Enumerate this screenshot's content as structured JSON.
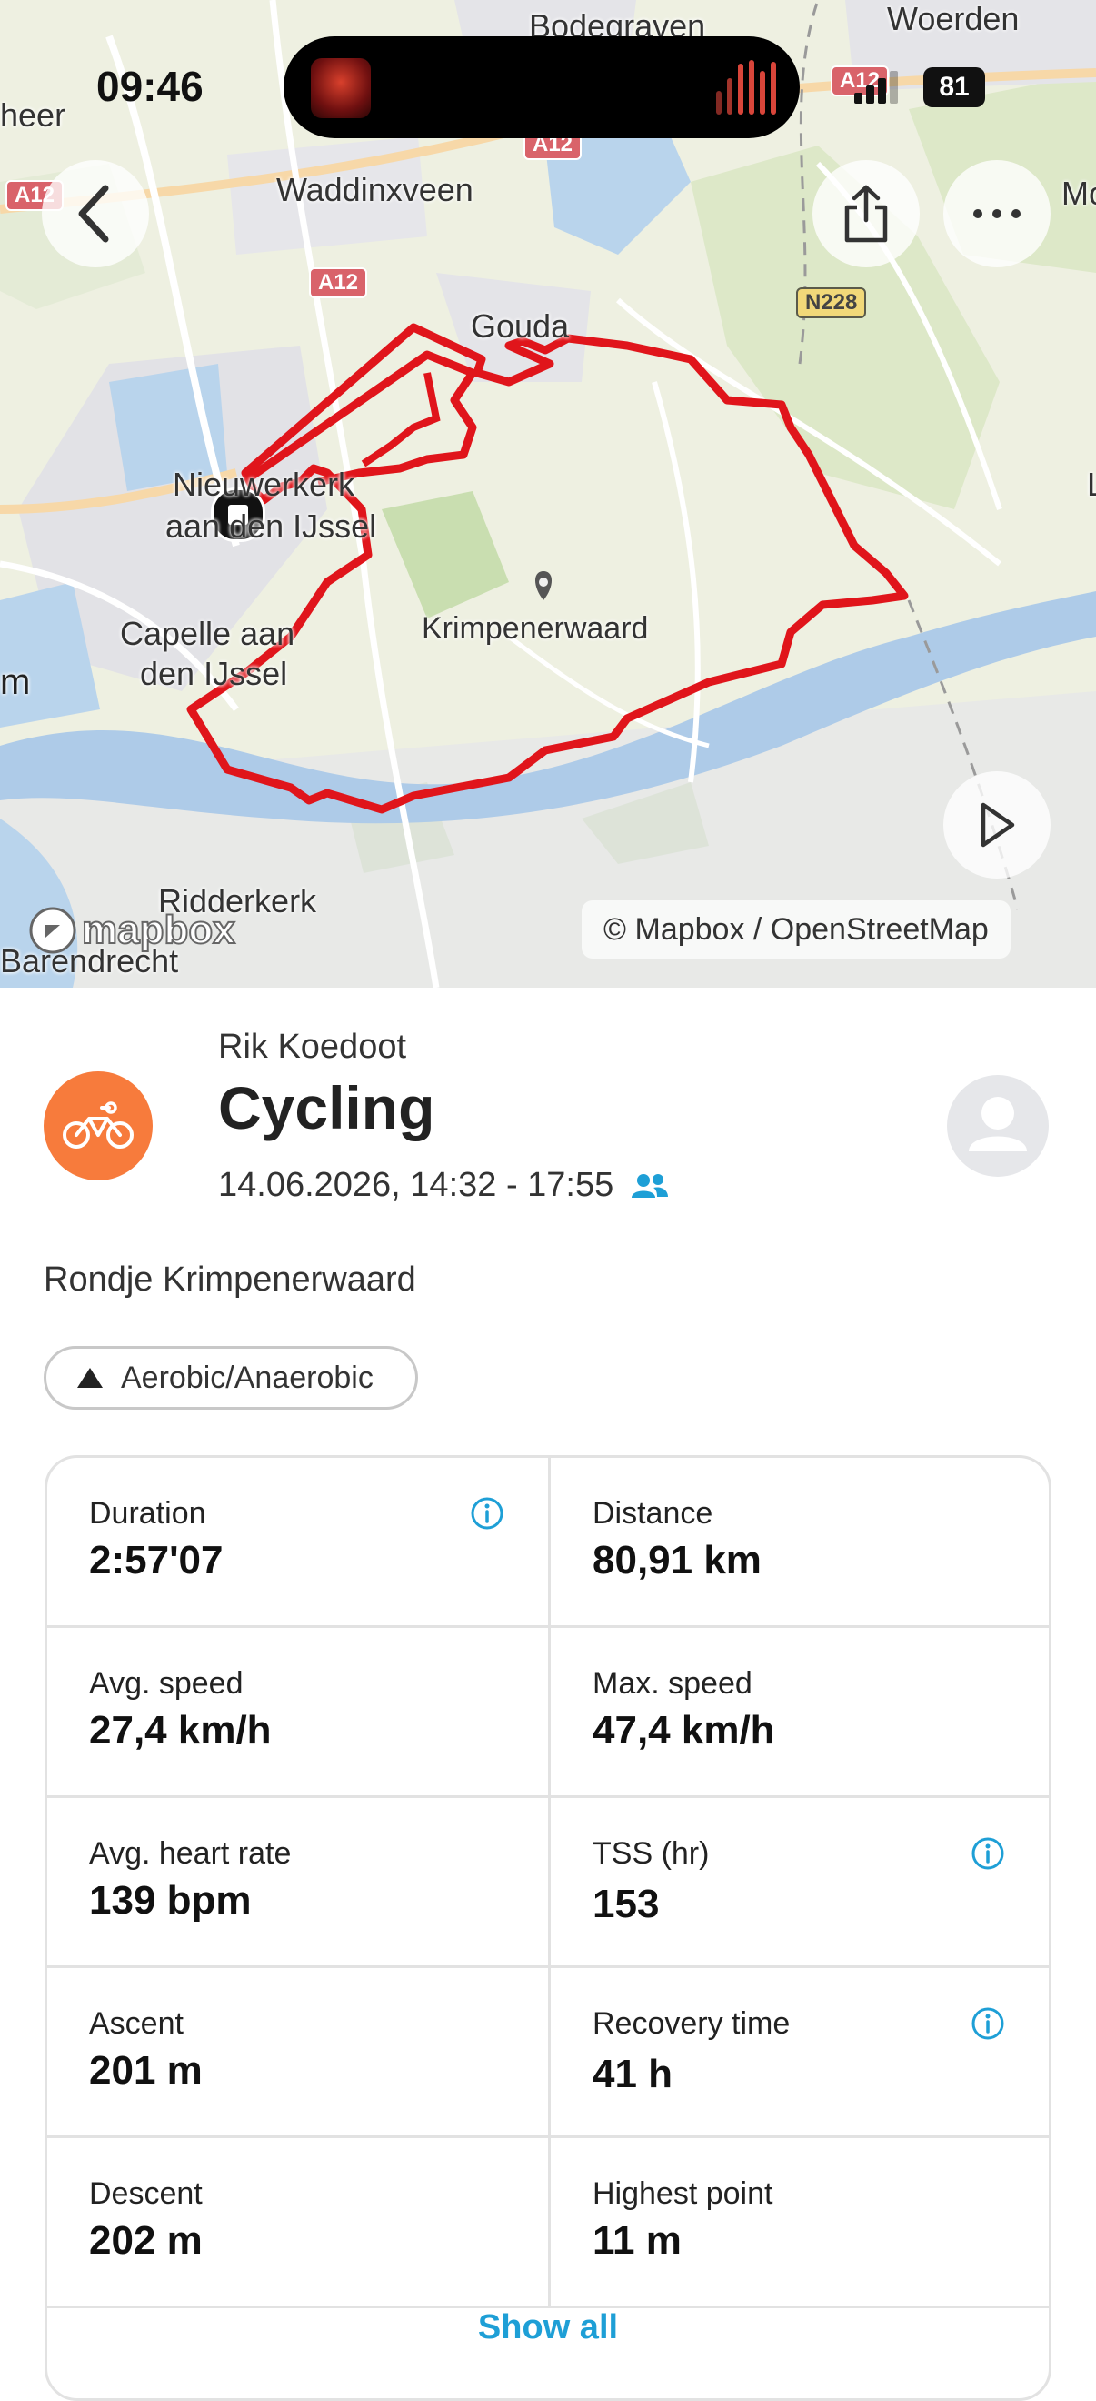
{
  "status_bar": {
    "time": "09:46",
    "battery": "81"
  },
  "map": {
    "labels": {
      "bodegraven": "Bodegraven",
      "woerden": "Woerden",
      "heer": "heer",
      "waddinxveen": "Waddinxveen",
      "mo": "Mo",
      "gouda": "Gouda",
      "nieuwerkerk_1": "Nieuwerkerk",
      "nieuwerkerk_2": "aan den IJssel",
      "capelle_1": "Capelle aan",
      "capelle_2": "den IJssel",
      "m": "m",
      "krimpenerwaard": "Krimpenerwaard",
      "l": "L",
      "ridderkerk": "Ridderkerk",
      "barendrecht": "Barendrecht"
    },
    "road_shields": {
      "a12_top": "A12",
      "a12_left": "A12",
      "a12_mid": "A12",
      "a12_right": "A12",
      "n228": "N228"
    },
    "attribution": "© Mapbox / OpenStreetMap",
    "logo": "mapbox",
    "route_color": "#e0151b"
  },
  "activity": {
    "user": "Rik Koedoot",
    "type": "Cycling",
    "date_range": "14.06.2026, 14:32 - 17:55",
    "description": "Rondje Krimpenerwaard",
    "tag": "Aerobic/Anaerobic",
    "accent_color": "#f77b3c"
  },
  "stats": [
    {
      "label": "Duration",
      "value": "2:57'07",
      "info": true
    },
    {
      "label": "Distance",
      "value": "80,91 km",
      "info": false
    },
    {
      "label": "Avg. speed",
      "value": "27,4 km/h",
      "info": false
    },
    {
      "label": "Max. speed",
      "value": "47,4 km/h",
      "info": false
    },
    {
      "label": "Avg. heart rate",
      "value": "139 bpm",
      "info": false
    },
    {
      "label": "TSS (hr)",
      "value": "153",
      "info": true
    },
    {
      "label": "Ascent",
      "value": "201 m",
      "info": false
    },
    {
      "label": "Recovery time",
      "value": "41 h",
      "info": true
    },
    {
      "label": "Descent",
      "value": "202 m",
      "info": false
    },
    {
      "label": "Highest point",
      "value": "11 m",
      "info": false
    }
  ],
  "show_all_label": "Show all",
  "link_color": "#1e9fd6"
}
